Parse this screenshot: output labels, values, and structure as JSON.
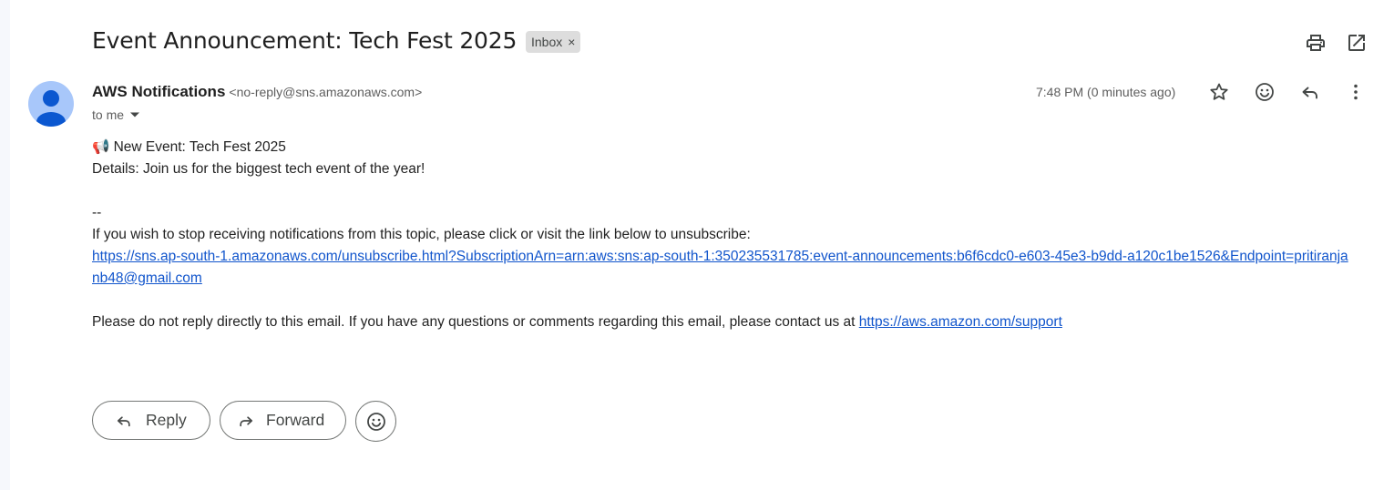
{
  "subject": "Event Announcement: Tech Fest 2025",
  "label": {
    "text": "Inbox",
    "remove_glyph": "×"
  },
  "top_actions": {
    "print_icon": "print-icon",
    "open_new_window_icon": "open-in-new-window-icon"
  },
  "sender": {
    "name": "AWS Notifications",
    "email": "<no-reply@sns.amazonaws.com>",
    "avatar_icon": "person-icon"
  },
  "recipient": {
    "text": "to me"
  },
  "timestamp": "7:48 PM (0 minutes ago)",
  "message_actions": [
    "star-icon",
    "emoji-reaction-icon",
    "reply-icon",
    "more-options-icon"
  ],
  "body": {
    "line1": "📢 New Event: Tech Fest 2025",
    "line2": "Details: Join us for the biggest tech event of the year!",
    "separator": "--",
    "unsubscribe_text": "If you wish to stop receiving notifications from this topic, please click or visit the link below to unsubscribe:",
    "unsubscribe_link": "https://sns.ap-south-1.amazonaws.com/unsubscribe.html?SubscriptionArn=arn:aws:sns:ap-south-1:350235531785:event-announcements:b6f6cdc0-e603-45e3-b9dd-a120c1be1526&Endpoint=pritiranjanb48@gmail.com",
    "contact_text": "Please do not reply directly to this email. If you have any questions or comments regarding this email, please contact us at ",
    "contact_link": "https://aws.amazon.com/support"
  },
  "buttons": {
    "reply": "Reply",
    "forward": "Forward"
  },
  "colors": {
    "link": "#1155cc",
    "avatar_bg": "#a8c7fa",
    "avatar_fg": "#0b57d0",
    "chip_bg": "#dddddd"
  }
}
